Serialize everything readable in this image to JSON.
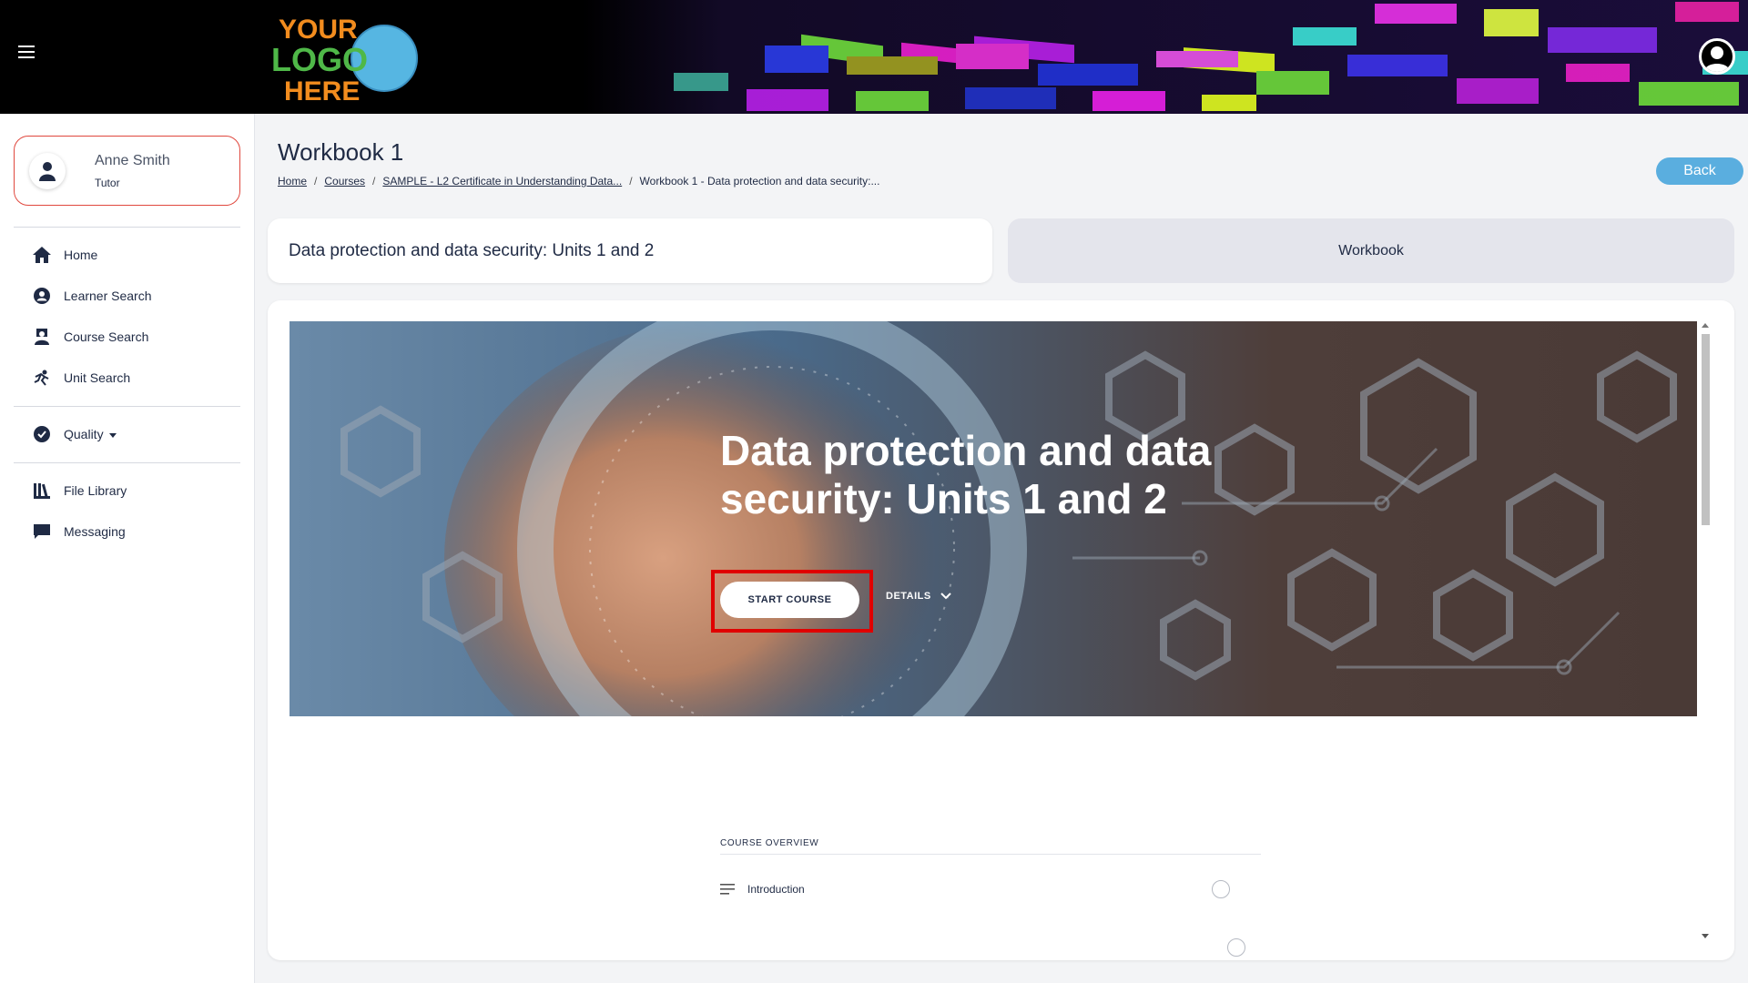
{
  "header": {
    "logo_lines": [
      "YOUR",
      "LOGO",
      "HERE"
    ],
    "menu_icon": "hamburger-icon",
    "profile_icon": "user-circle-icon"
  },
  "sidebar": {
    "user": {
      "name": "Anne Smith",
      "role": "Tutor"
    },
    "nav": [
      {
        "label": "Home",
        "icon": "home-icon"
      },
      {
        "label": "Learner Search",
        "icon": "user-circle-icon"
      },
      {
        "label": "Course Search",
        "icon": "course-icon"
      },
      {
        "label": "Unit Search",
        "icon": "unit-icon"
      },
      {
        "label": "Quality",
        "icon": "check-circle-icon"
      },
      {
        "label": "File Library",
        "icon": "library-icon"
      },
      {
        "label": "Messaging",
        "icon": "message-icon"
      }
    ]
  },
  "main": {
    "title": "Workbook 1",
    "breadcrumb": [
      "Home",
      "Courses",
      "SAMPLE - L2 Certificate in Understanding Data...",
      "Workbook 1 - Data protection and data security:..."
    ],
    "back_label": "Back",
    "course_title": "Data protection and data security: Units 1 and 2",
    "workbook_tab": "Workbook",
    "hero": {
      "title": "Data protection and data security: Units 1 and 2",
      "start_label": "START COURSE",
      "details_label": "DETAILS"
    },
    "overview": {
      "label": "COURSE OVERVIEW",
      "lessons": [
        "Introduction"
      ]
    }
  },
  "colors": {
    "accent": "#5aaedf",
    "highlight": "#e00000",
    "text": "#1f2a44"
  }
}
